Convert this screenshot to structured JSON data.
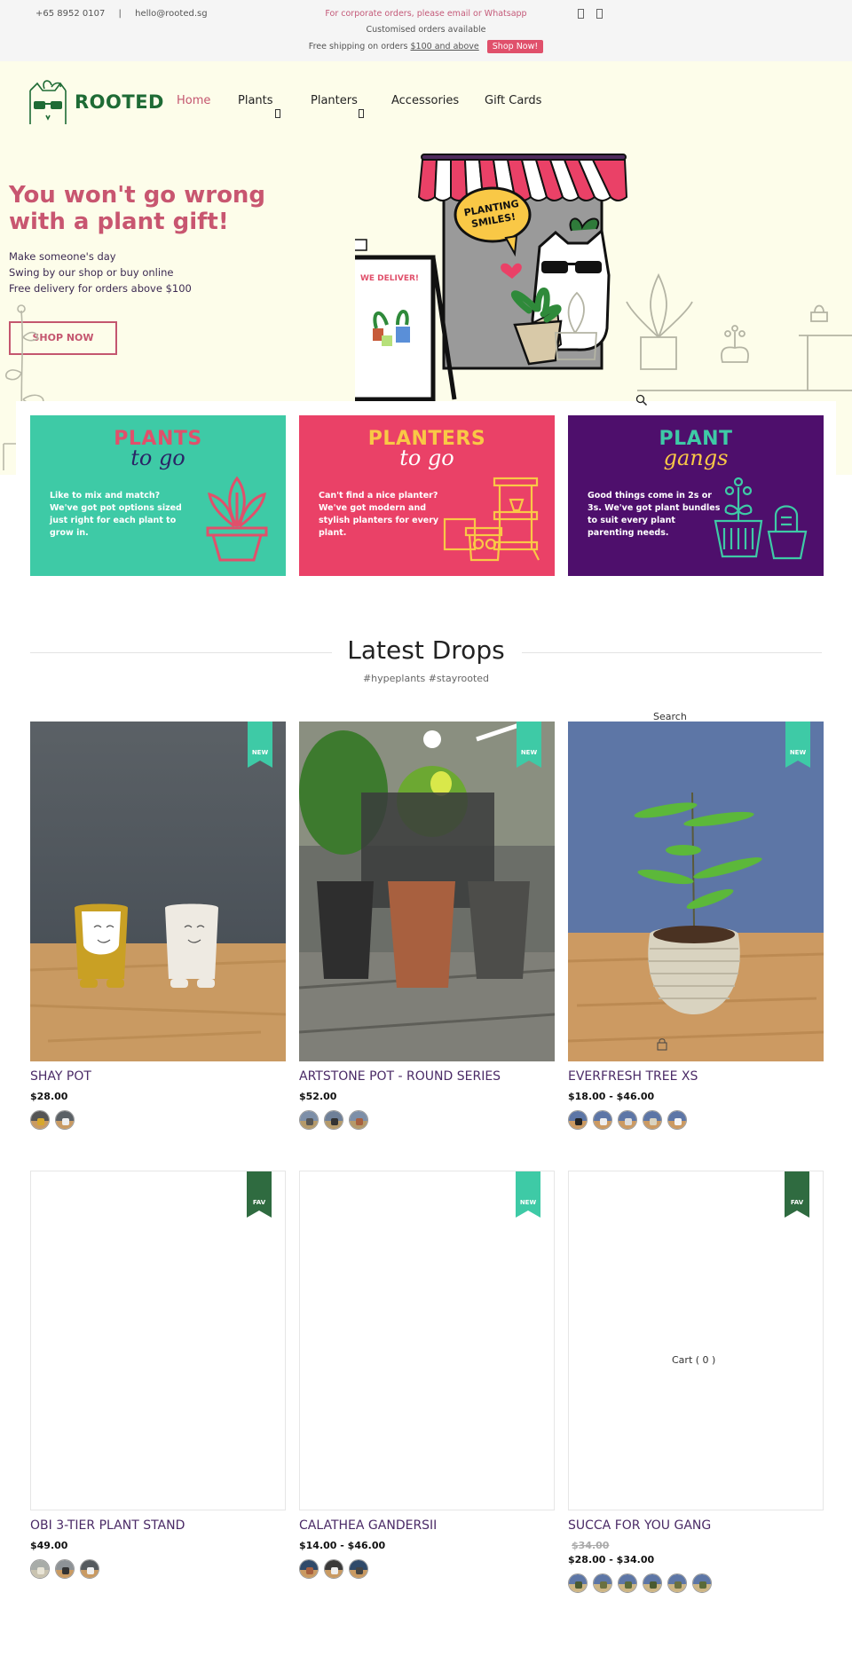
{
  "topbar": {
    "phone": "+65 8952 0107",
    "separator": "|",
    "email": "hello@rooted.sg",
    "promo_corporate": "For corporate orders, please email or Whatsapp",
    "promo_custom": "Customised orders available",
    "promo_shipping_prefix": "Free shipping on orders ",
    "promo_shipping_link": "$100 and above",
    "shop_now_label": "Shop Now!",
    "icons": [
      "account-icon",
      "cart-icon"
    ]
  },
  "header": {
    "logo_text": "ROOTED",
    "nav": [
      {
        "label": "Home",
        "active": true,
        "has_dropdown": false
      },
      {
        "label": "Plants",
        "active": false,
        "has_dropdown": true
      },
      {
        "label": "Planters",
        "active": false,
        "has_dropdown": true
      },
      {
        "label": "Accessories",
        "active": false,
        "has_dropdown": false
      },
      {
        "label": "Gift Cards",
        "active": false,
        "has_dropdown": false
      }
    ]
  },
  "hero": {
    "title": "You won't go wrong with a plant gift!",
    "lines": [
      "Make someone's day",
      "Swing by our shop or buy online",
      "Free delivery for orders above $100"
    ],
    "button_label": "SHOP NOW",
    "illustration_speech": "PLANTING SMILES!",
    "illustration_sign": "WE DELIVER!"
  },
  "categories": [
    {
      "title": "PLANTS",
      "script": "to go",
      "desc": "Like to mix and match? We've got pot options sized just right for each plant to grow in.",
      "bg": "#3ecaa6",
      "title_color": "#e0506b",
      "script_color": "#2a2466"
    },
    {
      "title": "PLANTERS",
      "script": "to go",
      "desc": "Can't find a nice planter? We've got modern and stylish planters for every plant.",
      "bg": "#ea4167",
      "title_color": "#f9c846",
      "script_color": "#ffffff"
    },
    {
      "title": "PLANT",
      "script": "gangs",
      "desc": "Good things come in 2s or 3s. We've got plant bundles to suit every plant parenting needs.",
      "bg": "#4e0f6c",
      "title_color": "#3ecaa6",
      "script_color": "#f9c846"
    }
  ],
  "latest": {
    "title": "Latest Drops",
    "subtitle": "#hypeplants #stayrooted",
    "floating_search": "Search",
    "floating_cart": "Cart ( 0 )"
  },
  "products": [
    {
      "name": "SHAY POT",
      "price": "$28.00",
      "old_price": null,
      "badge": "NEW",
      "badge_color": "#3ecaa6",
      "swatch_count": 2
    },
    {
      "name": "ARTSTONE POT - ROUND SERIES",
      "price": "$52.00",
      "old_price": null,
      "badge": "NEW",
      "badge_color": "#3ecaa6",
      "swatch_count": 3
    },
    {
      "name": "EVERFRESH TREE XS",
      "price": "$18.00 - $46.00",
      "old_price": null,
      "badge": "NEW",
      "badge_color": "#3ecaa6",
      "swatch_count": 5
    },
    {
      "name": "OBI 3-TIER PLANT STAND",
      "price": "$49.00",
      "old_price": null,
      "badge": "FAV",
      "badge_color": "#2f6b40",
      "swatch_count": 3
    },
    {
      "name": "CALATHEA GANDERSII",
      "price": "$14.00 - $46.00",
      "old_price": null,
      "badge": "NEW",
      "badge_color": "#3ecaa6",
      "swatch_count": 3
    },
    {
      "name": "SUCCA FOR YOU GANG",
      "price": "$28.00 - $34.00",
      "old_price": "$34.00",
      "badge": "FAV",
      "badge_color": "#2f6b40",
      "swatch_count": 6
    }
  ],
  "colors": {
    "accent_pink": "#c4566f",
    "brand_green": "#1e6b35",
    "hero_bg": "#fdfdea",
    "product_name": "#4a2a66"
  }
}
